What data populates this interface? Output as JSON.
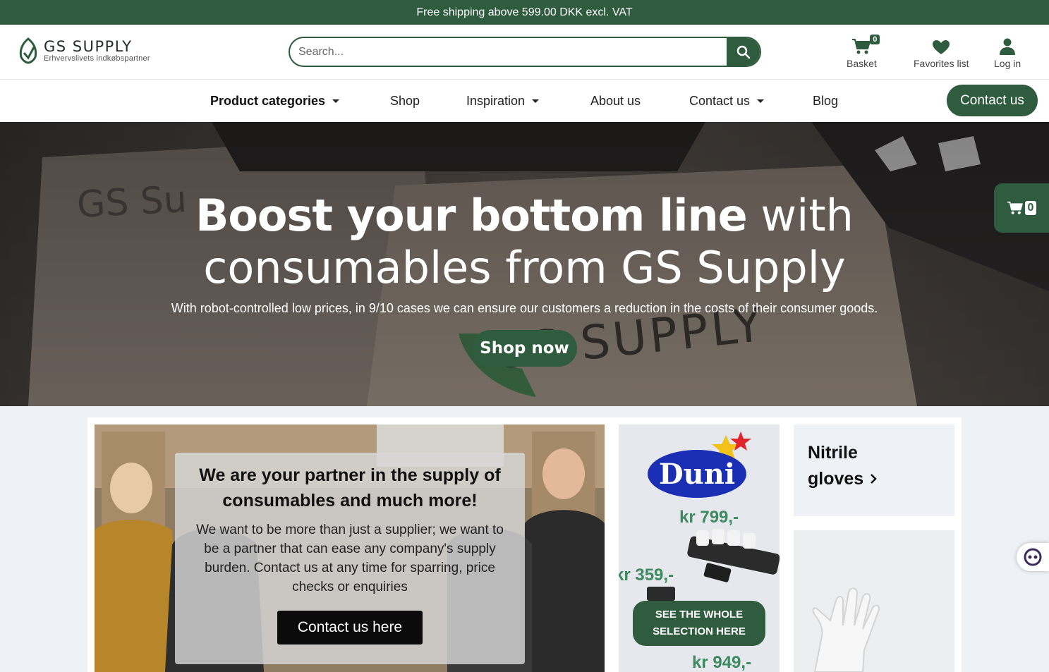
{
  "topbar": {
    "text": "Free shipping above  599.00 DKK excl. VAT"
  },
  "logo": {
    "name": "GS SUPPLY",
    "tagline": "Erhvervslivets indkøbspartner"
  },
  "search": {
    "placeholder": "Search...",
    "icon": "search-icon"
  },
  "header_actions": {
    "basket": {
      "label": "Basket",
      "count": "0",
      "icon": "cart-icon"
    },
    "favorites": {
      "label": "Favorites list",
      "icon": "heart-icon"
    },
    "login": {
      "label": "Log in",
      "icon": "user-icon"
    }
  },
  "nav": {
    "items": [
      {
        "label": "Product categories",
        "dropdown": true
      },
      {
        "label": "Shop",
        "dropdown": false
      },
      {
        "label": "Inspiration",
        "dropdown": true
      },
      {
        "label": "About us",
        "dropdown": false
      },
      {
        "label": "Contact us",
        "dropdown": true
      },
      {
        "label": "Blog",
        "dropdown": false
      }
    ],
    "cta": "Contact us"
  },
  "hero": {
    "title_bold": "Boost your bottom line",
    "title_rest": " with",
    "title_line2": "consumables from GS Supply",
    "subtitle": "With robot-controlled low prices, in 9/10 cases we can ensure our customers a reduction in the costs of their consumer goods.",
    "button": "Shop now",
    "box_text_1": "GS Su",
    "box_text_2": "GS SUPPLY"
  },
  "side_cart": {
    "count": "0"
  },
  "team_card": {
    "title": "We are your partner in the supply of consumables and much more!",
    "text": "We want to be more than just a supplier; we want to be a partner that can ease any company's supply burden. Contact us at any time for sparring, price checks or enquiries",
    "button": "Contact us here"
  },
  "duni_ad": {
    "brand": "Duni",
    "price_1": "kr 799,-",
    "price_2": "kr 359,-",
    "price_3": "kr 949,-",
    "button": "SEE THE WHOLE SELECTION HERE"
  },
  "nitrile": {
    "title_line1": "Nitrile",
    "title_line2": "gloves"
  },
  "colors": {
    "brand_green": "#2f5b3f",
    "price_green": "#3d8a5e",
    "duni_blue": "#1b2fb5"
  }
}
